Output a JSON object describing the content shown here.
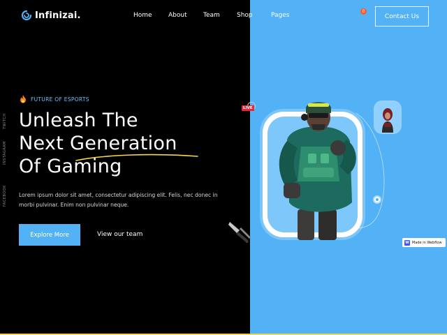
{
  "brand": {
    "name": "Infinizai."
  },
  "nav": {
    "items": [
      {
        "label": "Home"
      },
      {
        "label": "About"
      },
      {
        "label": "Team"
      },
      {
        "label": "Shop"
      },
      {
        "label": "Pages"
      }
    ],
    "cart_count": "0",
    "contact_label": "Contact Us"
  },
  "social": [
    "TWITCH",
    "INSTAGRAM",
    "FACEBOOK"
  ],
  "hero": {
    "eyebrow": "FUTURE OF ESPORTS",
    "headline_1": "Unleash The",
    "headline_2_pre": "Next ",
    "headline_2_accent": "Generation",
    "headline_3": "Of Gaming",
    "description": "Lorem ipsum dolor sit amet, consectetur adipiscing elit. Felis, nec donec in morbi pulvinar. Enim non pulvinar neque.",
    "primary_cta": "Explore More",
    "secondary_cta": "View our team"
  },
  "badges": {
    "live": "LIVE",
    "webflow": "Made in Webflow",
    "webflow_icon": "W"
  },
  "colors": {
    "accent": "#52b2f5",
    "underline": "#f7d84a",
    "live": "#e7263b",
    "background": "#000000"
  },
  "icons": [
    "logo-icon",
    "cart-icon",
    "flame-icon",
    "webflow-icon"
  ]
}
